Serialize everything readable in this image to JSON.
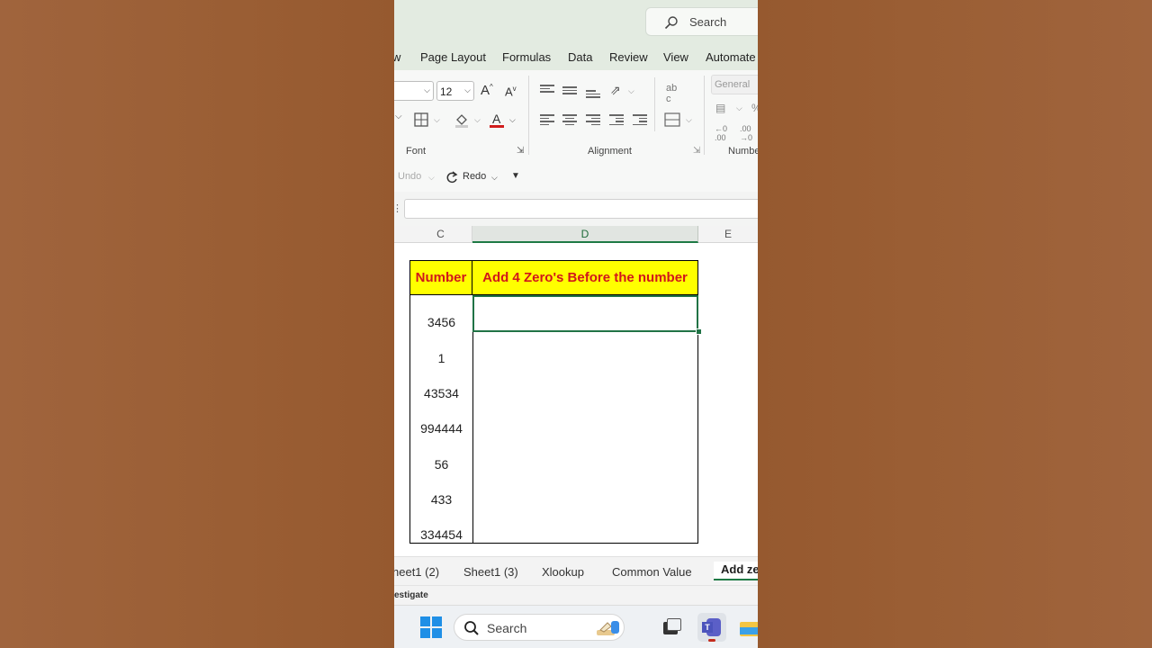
{
  "search": {
    "label": "Search"
  },
  "menu": {
    "tabs": [
      "w",
      "Page Layout",
      "Formulas",
      "Data",
      "Review",
      "View",
      "Automate"
    ]
  },
  "ribbon": {
    "font_size": "12",
    "number_format": "General",
    "groups": {
      "font": "Font",
      "alignment": "Alignment",
      "number": "Numbe"
    }
  },
  "qat": {
    "undo": "Undo",
    "redo": "Redo"
  },
  "columns": [
    "C",
    "D",
    "E"
  ],
  "table": {
    "header_c": "Number",
    "header_d": "Add 4 Zero's Before the number",
    "numbers": [
      "3456",
      "1",
      "43534",
      "994444",
      "56",
      "433",
      "334454"
    ]
  },
  "sheet_tabs": [
    "heet1 (2)",
    "Sheet1 (3)",
    "Xlookup",
    "Common Value",
    "Add ze"
  ],
  "status": {
    "text": "estigate"
  },
  "taskbar": {
    "search_label": "Search"
  },
  "colors": {
    "header_fill": "#ffff00",
    "header_text": "#d1161b",
    "excel_green": "#217346",
    "backdrop": "#9a5e34"
  }
}
